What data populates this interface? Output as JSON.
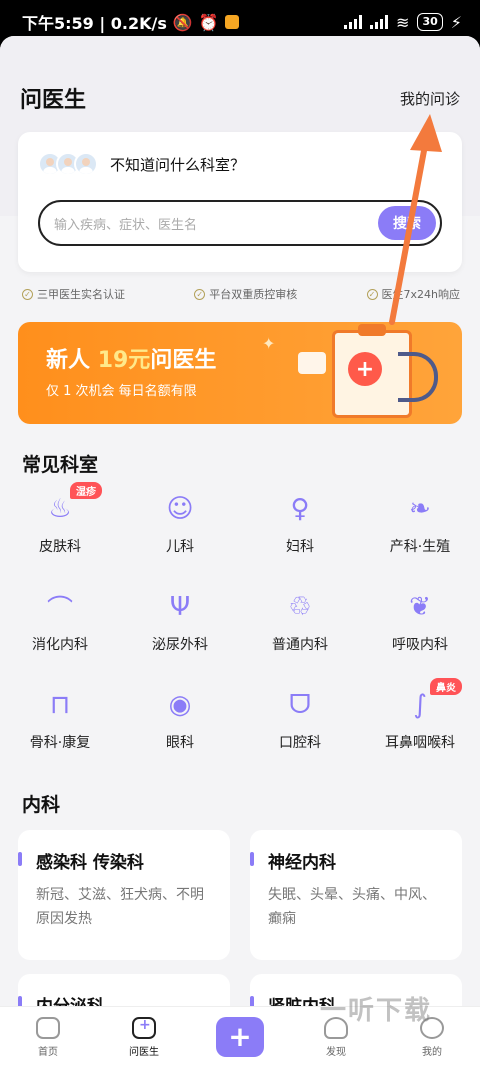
{
  "status_bar": {
    "time_speed": "下午5:59 | 0.2K/s",
    "battery": "30"
  },
  "header": {
    "title": "问医生",
    "my_consult": "我的问诊"
  },
  "search_card": {
    "question": "不知道问什么科室？",
    "placeholder": "输入疾病、症状、医生名",
    "search_label": "搜索"
  },
  "badges": [
    "三甲医生实名认证",
    "平台双重质控审核",
    "医生7x24h响应"
  ],
  "promo": {
    "title_prefix": "新人",
    "title_amount": "19元",
    "title_suffix": "问医生",
    "subtitle": "仅 1 次机会  每日名额有限"
  },
  "common_depts": {
    "title": "常见科室",
    "items": [
      {
        "label": "皮肤科",
        "icon": "skin-icon",
        "tag": "湿疹"
      },
      {
        "label": "儿科",
        "icon": "child-face-icon",
        "tag": ""
      },
      {
        "label": "妇科",
        "icon": "uterus-icon",
        "tag": ""
      },
      {
        "label": "产科·生殖",
        "icon": "obstetrics-icon",
        "tag": ""
      },
      {
        "label": "消化内科",
        "icon": "stomach-icon",
        "tag": ""
      },
      {
        "label": "泌尿外科",
        "icon": "urinary-icon",
        "tag": ""
      },
      {
        "label": "普通内科",
        "icon": "kidney-icon",
        "tag": ""
      },
      {
        "label": "呼吸内科",
        "icon": "lungs-icon",
        "tag": ""
      },
      {
        "label": "骨科·康复",
        "icon": "bone-icon",
        "tag": ""
      },
      {
        "label": "眼科",
        "icon": "eye-icon",
        "tag": ""
      },
      {
        "label": "口腔科",
        "icon": "tooth-icon",
        "tag": ""
      },
      {
        "label": "耳鼻咽喉科",
        "icon": "nose-icon",
        "tag": "鼻炎"
      }
    ]
  },
  "internal": {
    "title": "内科",
    "cards": [
      {
        "title": "感染科 传染科",
        "desc": "新冠、艾滋、狂犬病、不明原因发热"
      },
      {
        "title": "神经内科",
        "desc": "失眠、头晕、头痛、中风、癫痫"
      },
      {
        "title": "内分泌科",
        "desc": ""
      },
      {
        "title": "肾脏内科",
        "desc": ""
      }
    ]
  },
  "tabbar": {
    "home": "首页",
    "ask_doctor": "问医生",
    "discover": "发现",
    "mine": "我的"
  },
  "watermark": "一听下载",
  "colors": {
    "accent": "#8b7cf7",
    "promo": "#ff8f1c",
    "tag": "#ff5357",
    "arrow": "#f37a3d"
  }
}
